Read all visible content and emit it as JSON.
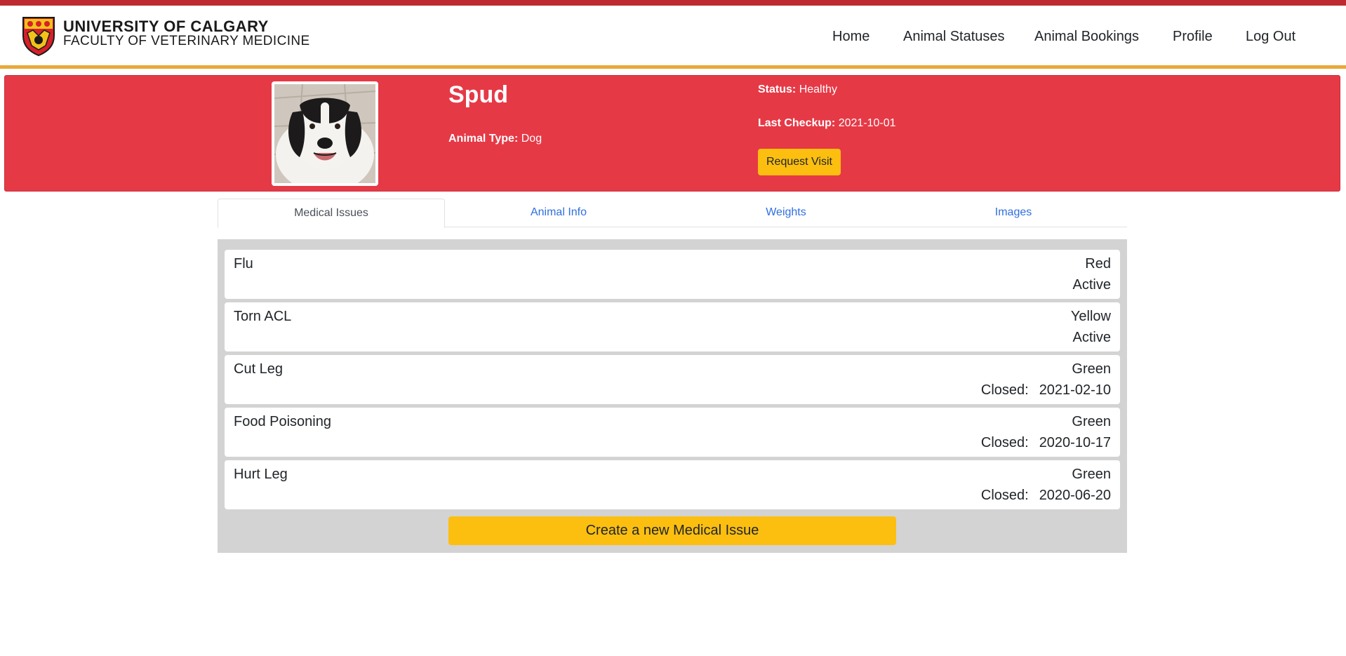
{
  "brand": {
    "line1": "UNIVERSITY OF CALGARY",
    "line2": "FACULTY OF VETERINARY MEDICINE",
    "logo_icon": "university-crest-icon"
  },
  "colors": {
    "top_bar": "#be2a2f",
    "accent_line": "#e8a93b",
    "banner": "#e63946",
    "button": "#fcbf10",
    "panel": "#d3d3d3",
    "tab_link": "#2f6fe0"
  },
  "nav": {
    "items": [
      {
        "label": "Home"
      },
      {
        "label": "Animal Statuses"
      },
      {
        "label": "Animal Bookings"
      },
      {
        "label": "Profile"
      },
      {
        "label": "Log Out"
      }
    ]
  },
  "animal": {
    "name": "Spud",
    "type_label": "Animal Type:",
    "type": "Dog",
    "status_label": "Status:",
    "status": "Healthy",
    "checkup_label": "Last Checkup:",
    "last_checkup": "2021-10-01",
    "request_visit": "Request Visit"
  },
  "tabs": [
    {
      "label": "Medical Issues",
      "active": true
    },
    {
      "label": "Animal Info",
      "active": false
    },
    {
      "label": "Weights",
      "active": false
    },
    {
      "label": "Images",
      "active": false
    }
  ],
  "medical_issues": [
    {
      "name": "Flu",
      "severity": "Red",
      "state": "Active"
    },
    {
      "name": "Torn ACL",
      "severity": "Yellow",
      "state": "Active"
    },
    {
      "name": "Cut Leg",
      "severity": "Green",
      "closed_label": "Closed:",
      "closed_date": "2021-02-10"
    },
    {
      "name": "Food Poisoning",
      "severity": "Green",
      "closed_label": "Closed:",
      "closed_date": "2020-10-17"
    },
    {
      "name": "Hurt Leg",
      "severity": "Green",
      "closed_label": "Closed:",
      "closed_date": "2020-06-20"
    }
  ],
  "create_issue_button": "Create a new Medical Issue"
}
